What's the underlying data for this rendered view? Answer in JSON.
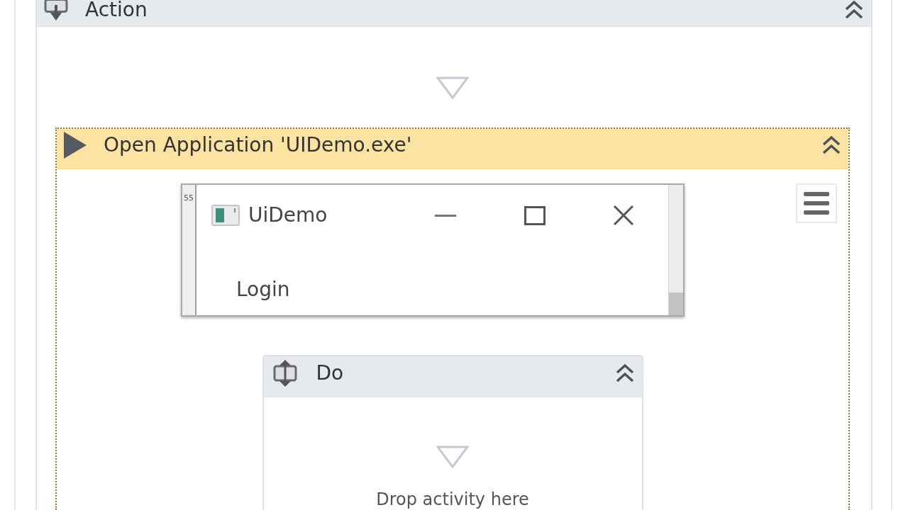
{
  "action": {
    "title": "Action",
    "selected": false,
    "open_application": {
      "title": "Open Application 'UIDemo.exe'",
      "selected": true,
      "screenshot": {
        "edge_text": "55",
        "window_title": "UiDemo",
        "content_text": "Login"
      },
      "do": {
        "title": "Do",
        "selected": false,
        "drop_hint": "Drop activity here"
      }
    }
  }
}
